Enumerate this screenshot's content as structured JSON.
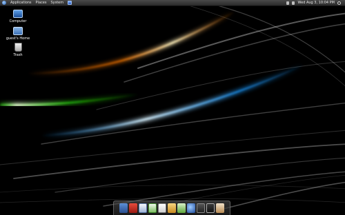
{
  "panel": {
    "menus": [
      "Applications",
      "Places",
      "System"
    ],
    "clock": "Wed Aug  3, 10:04 PM"
  },
  "desktop_icons": [
    {
      "label": "Computer",
      "icon": "computer-icon"
    },
    {
      "label": "guest's Home",
      "icon": "home-folder-icon"
    },
    {
      "label": "Trash",
      "icon": "trash-icon"
    }
  ],
  "dock_icons": [
    "anchor-icon",
    "pdf-reader-icon",
    "document-icon",
    "spreadsheet-icon",
    "text-file-icon",
    "image-editor-icon",
    "checkbox-icon",
    "browser-icon",
    "media-player-icon",
    "clapperboard-icon",
    "eye-icon"
  ],
  "colors": {
    "orange_streak": "#ff8a1e",
    "green_streak": "#4cff2a",
    "blue_streak": "#2aa8ff",
    "background": "#000000"
  }
}
